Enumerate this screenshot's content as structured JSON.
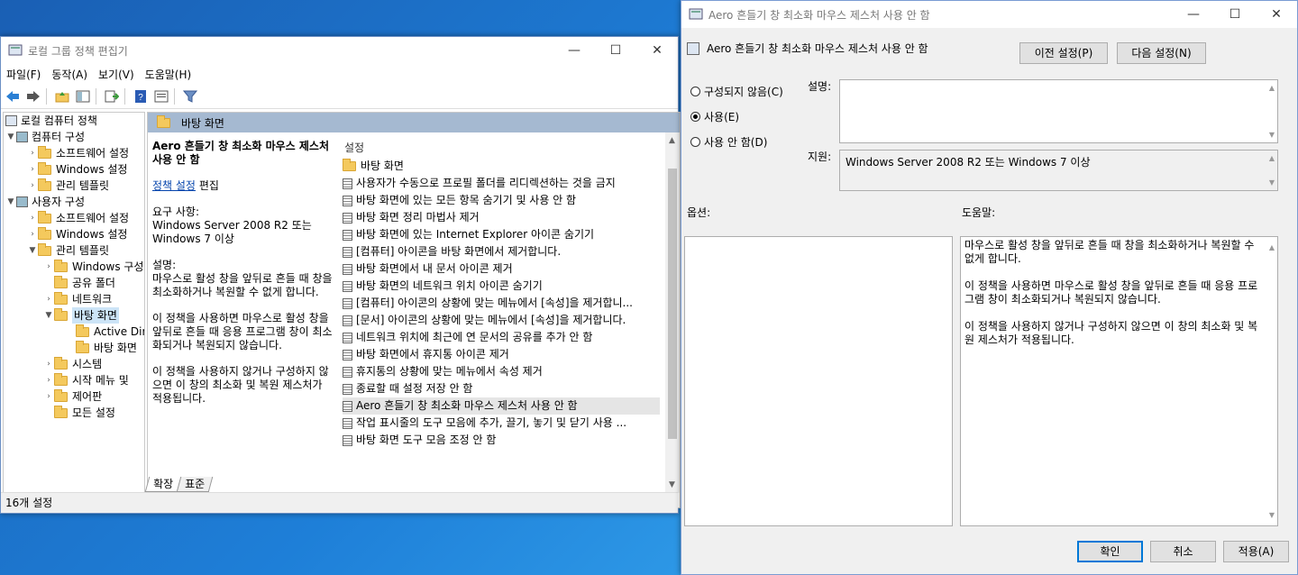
{
  "gpe": {
    "title": "로컬 그룹 정책 편집기",
    "menu": [
      "파일(F)",
      "동작(A)",
      "보기(V)",
      "도움말(H)"
    ],
    "tree": {
      "root": "로컬 컴퓨터 정책",
      "computer": "컴퓨터 구성",
      "c_software": "소프트웨어 설정",
      "c_windows": "Windows 설정",
      "c_admin": "관리 템플릿",
      "user": "사용자 구성",
      "u_software": "소프트웨어 설정",
      "u_windows": "Windows 설정",
      "u_admin": "관리 템플릿",
      "windows_components": "Windows 구성",
      "shared_folders": "공유 폴더",
      "network": "네트워크",
      "desktop": "바탕 화면",
      "active_dir": "Active Dir",
      "desktop_sub": "바탕 화면",
      "system": "시스템",
      "start_menu": "시작 메뉴 및",
      "control_panel": "제어판",
      "all_settings": "모든 설정"
    },
    "pane_header": "바탕 화면",
    "desc": {
      "title": "Aero 흔들기 창 최소화 마우스 제스처 사용 안 함",
      "edit_link": "정책 설정",
      "edit_suffix": "편집",
      "req_label": "요구 사항:",
      "req_text": "Windows Server 2008 R2 또는 Windows 7 이상",
      "desc_label": "설명:",
      "desc_text": "마우스로 활성 창을 앞뒤로 흔들 때 창을 최소화하거나 복원할 수 없게 합니다.",
      "p2": "이 정책을 사용하면 마우스로 활성 창을 앞뒤로 흔들 때 응용 프로그램 창이 최소화되거나 복원되지 않습니다.",
      "p3": "이 정책을 사용하지 않거나 구성하지 않으면 이 창의 최소화 및 복원 제스처가 적용됩니다."
    },
    "list_header": "설정",
    "items": [
      "바탕 화면",
      "사용자가 수동으로 프로필 폴더를 리디렉션하는 것을 금지",
      "바탕 화면에 있는 모든 항목 숨기기 및 사용 안 함",
      "바탕 화면 정리 마법사 제거",
      "바탕 화면에 있는 Internet Explorer 아이콘 숨기기",
      "[컴퓨터] 아이콘을 바탕 화면에서 제거합니다.",
      "바탕 화면에서 내 문서 아이콘 제거",
      "바탕 화면의 네트워크 위치 아이콘 숨기기",
      "[컴퓨터] 아이콘의 상황에 맞는 메뉴에서 [속성]을 제거합니...",
      "[문서] 아이콘의 상황에 맞는 메뉴에서 [속성]을 제거합니다.",
      "네트워크 위치에 최근에 연 문서의 공유를 추가 안 함",
      "바탕 화면에서 휴지통 아이콘 제거",
      "휴지통의 상황에 맞는 메뉴에서 속성 제거",
      "종료할 때 설정 저장 안 함",
      "Aero 흔들기 창 최소화 마우스 제스처 사용 안 함",
      "작업 표시줄의 도구 모음에 추가, 끌기, 놓기 및 닫기 사용 ...",
      "바탕 화면 도구 모음 조정 안 함"
    ],
    "tabs": [
      "확장",
      "표준"
    ],
    "status": "16개 설정"
  },
  "dialog": {
    "title": "Aero 흔들기 창 최소화 마우스 제스처 사용 안 함",
    "header": "Aero 흔들기 창 최소화 마우스 제스처 사용 안 함",
    "prev_btn": "이전 설정(P)",
    "next_btn": "다음 설정(N)",
    "radio_not_configured": "구성되지 않음(C)",
    "radio_enabled": "사용(E)",
    "radio_disabled": "사용 안 함(D)",
    "comment_label": "설명:",
    "supported_label": "지원:",
    "supported_text": "Windows Server 2008 R2 또는 Windows 7 이상",
    "options_label": "옵션:",
    "help_label": "도움말:",
    "help_p1": "마우스로 활성 창을 앞뒤로 흔들 때 창을 최소화하거나 복원할 수 없게 합니다.",
    "help_p2": "이 정책을 사용하면 마우스로 활성 창을 앞뒤로 흔들 때 응용 프로그램 창이 최소화되거나 복원되지 않습니다.",
    "help_p3": "이 정책을 사용하지 않거나 구성하지 않으면 이 창의 최소화 및 복원 제스처가 적용됩니다.",
    "ok_btn": "확인",
    "cancel_btn": "취소",
    "apply_btn": "적용(A)"
  }
}
